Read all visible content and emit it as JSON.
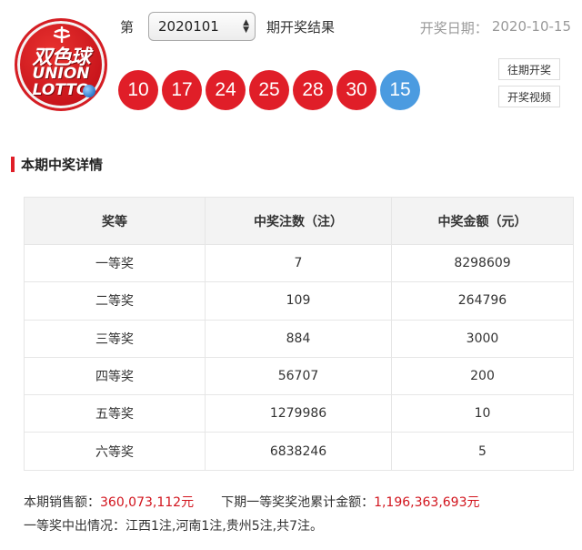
{
  "logo": {
    "text_cn": "双色球",
    "text_en_1": "UNION",
    "text_en_2": "LOTTO"
  },
  "header": {
    "issue_prefix": "第",
    "issue_value": "2020101",
    "issue_suffix": "期开奖结果",
    "date_label": "开奖日期：",
    "date_value": "2020-10-15"
  },
  "balls": {
    "red": [
      "10",
      "17",
      "24",
      "25",
      "28",
      "30"
    ],
    "blue": "15"
  },
  "buttons": {
    "history": "往期开奖",
    "video": "开奖视频"
  },
  "section": {
    "title": "本期中奖详情"
  },
  "table": {
    "headers": [
      "奖等",
      "中奖注数（注）",
      "中奖金额（元）"
    ],
    "rows": [
      [
        "一等奖",
        "7",
        "8298609"
      ],
      [
        "二等奖",
        "109",
        "264796"
      ],
      [
        "三等奖",
        "884",
        "3000"
      ],
      [
        "四等奖",
        "56707",
        "200"
      ],
      [
        "五等奖",
        "1279986",
        "10"
      ],
      [
        "六等奖",
        "6838246",
        "5"
      ]
    ]
  },
  "footer": {
    "sales_label": "本期销售额：",
    "sales_value": "360,073,112元",
    "pool_label": "下期一等奖奖池累计金额：",
    "pool_value": "1,196,363,693元",
    "first_prize_info": "一等奖中出情况：江西1注,河南1注,贵州5注,共7注。"
  },
  "colors": {
    "red": "#e01e28",
    "blue": "#4b9be0",
    "accent_text": "#d2141d"
  }
}
